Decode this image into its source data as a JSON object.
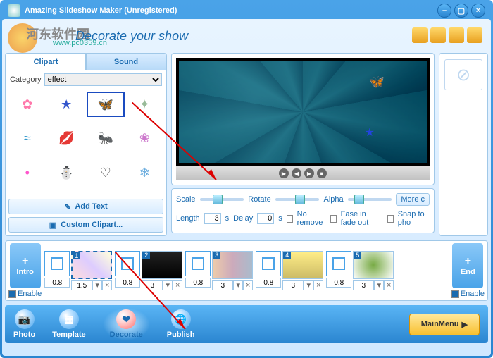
{
  "window": {
    "title": "Amazing Slideshow Maker (Unregistered)"
  },
  "watermark": {
    "text1": "河东软件园",
    "text2": "www.pc0359.cn"
  },
  "header": {
    "tagline": "Decorate your show"
  },
  "tabs": {
    "clipart": "Clipart",
    "sound": "Sound"
  },
  "category": {
    "label": "Category",
    "value": "effect"
  },
  "clips": [
    {
      "glyph": "✿",
      "color": "#f7a"
    },
    {
      "glyph": "★",
      "color": "#35c"
    },
    {
      "glyph": "🦋",
      "color": "#c22",
      "sel": true
    },
    {
      "glyph": "✦",
      "color": "#9b9"
    },
    {
      "glyph": "≈",
      "color": "#39c"
    },
    {
      "glyph": "💋",
      "color": "#e3a"
    },
    {
      "glyph": "🐜",
      "color": "#222"
    },
    {
      "glyph": "❀",
      "color": "#c7c"
    },
    {
      "glyph": "•",
      "color": "#f5c"
    },
    {
      "glyph": "⛄",
      "color": "#ddd"
    },
    {
      "glyph": "♡",
      "color": "#333"
    },
    {
      "glyph": "❄",
      "color": "#6ad"
    }
  ],
  "buttons": {
    "addText": "Add Text",
    "customClipart": "Custom Clipart...",
    "more": "More c"
  },
  "controls": {
    "scale": "Scale",
    "rotate": "Rotate",
    "alpha": "Alpha",
    "length": "Length",
    "lengthVal": "3",
    "sec": "s",
    "delay": "Delay",
    "delayVal": "0",
    "noRemove": "No remove",
    "fadeInOut": "Fase in fade out",
    "snap": "Snap to pho"
  },
  "timeline": {
    "intro": "Intro",
    "end": "End",
    "enable": "Enable",
    "plus": "+",
    "slides": [
      {
        "n": "1",
        "dur": "1.5",
        "t": "0.8",
        "art": "linear-gradient(45deg,#fdd,#dcf,#ffd)"
      },
      {
        "n": "2",
        "dur": "3",
        "t": "0.8",
        "art": "linear-gradient(#222,#000)"
      },
      {
        "n": "3",
        "dur": "3",
        "t": "0.8",
        "art": "linear-gradient(90deg,#eca,#cab,#abc)"
      },
      {
        "n": "4",
        "dur": "3",
        "t": "0.8",
        "art": "linear-gradient(#fe8,#cb6)"
      },
      {
        "n": "5",
        "dur": "3",
        "t": "0.8",
        "art": "radial-gradient(circle,#7a4,#fff)"
      }
    ]
  },
  "nav": {
    "photo": "Photo",
    "template": "Template",
    "decorate": "Decorate",
    "publish": "Publish",
    "mainMenu": "MainMenu"
  }
}
